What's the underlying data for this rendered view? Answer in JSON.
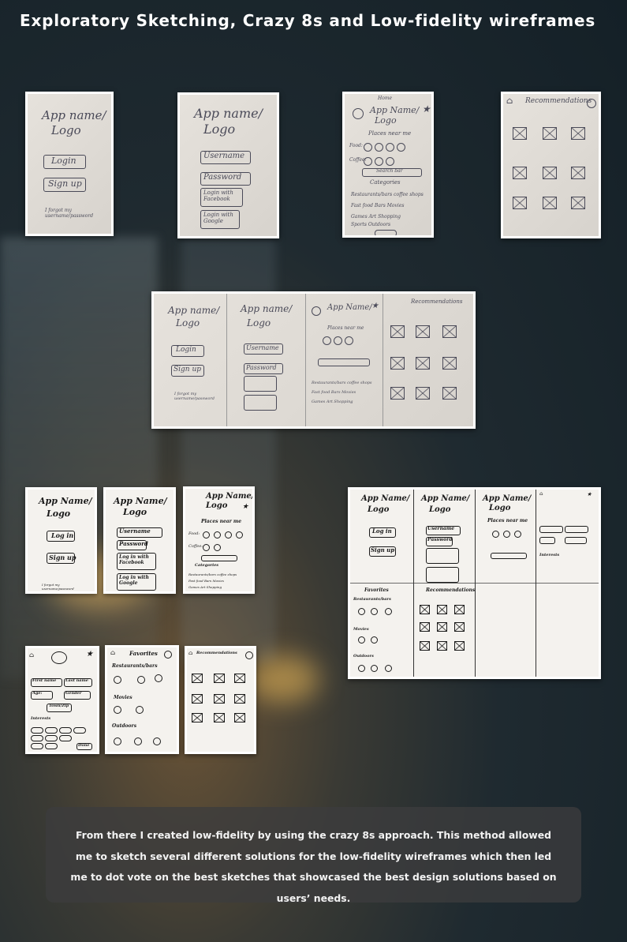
{
  "title": "Exploratory Sketching, Crazy 8s and Low-fidelity wireframes",
  "caption": "From there I created low-fidelity by using the crazy 8s approach. This method allowed me to sketch several different solutions for the low-fidelity wireframes which then led  me to dot vote on the best sketches that showcased the best design solutions based on users’ needs.",
  "sketch": {
    "app_name": "App name/",
    "logo": "Logo",
    "app_name_caps": "App Name/",
    "login": "Login",
    "log_in": "Log in",
    "sign_up": "Sign up",
    "forgot": "I forgot my username/password",
    "username": "Username",
    "password": "Password",
    "login_facebook": "Login with Facebook",
    "login_google": "Login with Google",
    "log_in_facebook": "Log in with Facebook",
    "log_in_google": "Log in with Google",
    "home": "Home",
    "places_near_me": "Places near me",
    "food": "Food:",
    "coffee": "Coffee:",
    "search_bar": "Search bar",
    "categories": "Categories",
    "restaurants_bars": "Restaurants/bars coffee shops",
    "fast_food": "Fast food  Bars  Movies",
    "games": "Games  Art  Shopping",
    "sports": "Sports  Outdoors",
    "results": "Results",
    "recommendations": "Recommendations",
    "favorites": "Favorites",
    "restaurants": "Restaurants/bars",
    "movies": "Movies",
    "outdoors": "Outdoors",
    "first_name": "First name",
    "last_name": "Last name",
    "age": "Age:",
    "gender": "Gender",
    "town_zip": "Town/Zip",
    "interests": "Interests",
    "done": "Done"
  }
}
